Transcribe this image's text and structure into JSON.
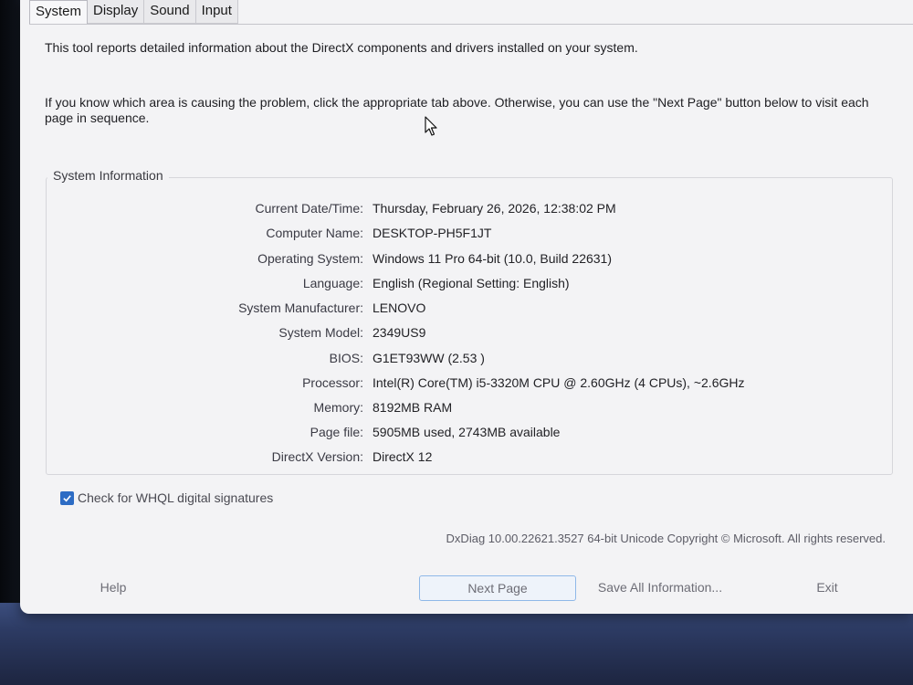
{
  "tabs": [
    {
      "label": "System",
      "active": true
    },
    {
      "label": "Display",
      "active": false
    },
    {
      "label": "Sound",
      "active": false
    },
    {
      "label": "Input",
      "active": false
    }
  ],
  "intro": {
    "line1": "This tool reports detailed information about the DirectX components and drivers installed on your system.",
    "line2": "If you know which area is causing the problem, click the appropriate tab above. Otherwise, you can use the \"Next Page\" button below to visit each page in sequence."
  },
  "system_info": {
    "group_label": "System Information",
    "rows": [
      {
        "label": "Current Date/Time:",
        "value": "Thursday, February 26, 2026, 12:38:02 PM"
      },
      {
        "label": "Computer Name:",
        "value": "DESKTOP-PH5F1JT"
      },
      {
        "label": "Operating System:",
        "value": "Windows 11 Pro 64-bit (10.0, Build 22631)"
      },
      {
        "label": "Language:",
        "value": "English (Regional Setting: English)"
      },
      {
        "label": "System Manufacturer:",
        "value": "LENOVO"
      },
      {
        "label": "System Model:",
        "value": "2349US9"
      },
      {
        "label": "BIOS:",
        "value": "G1ET93WW (2.53 )"
      },
      {
        "label": "Processor:",
        "value": "Intel(R) Core(TM) i5-3320M CPU @ 2.60GHz (4 CPUs), ~2.6GHz"
      },
      {
        "label": "Memory:",
        "value": "8192MB RAM"
      },
      {
        "label": "Page file:",
        "value": "5905MB used, 2743MB available"
      },
      {
        "label": "DirectX Version:",
        "value": "DirectX 12"
      }
    ]
  },
  "whql": {
    "label": "Check for WHQL digital signatures",
    "checked": true
  },
  "copyright": "DxDiag 10.00.22621.3527 64-bit Unicode  Copyright © Microsoft. All rights reserved.",
  "buttons": {
    "help": "Help",
    "next_page": "Next Page",
    "save_all": "Save All Information...",
    "exit": "Exit"
  },
  "colors": {
    "accent": "#2d6cc4",
    "window_bg": "#f3f3f5"
  },
  "icons": {
    "checkbox": "checkmark-icon",
    "cursor": "mouse-pointer-icon"
  }
}
